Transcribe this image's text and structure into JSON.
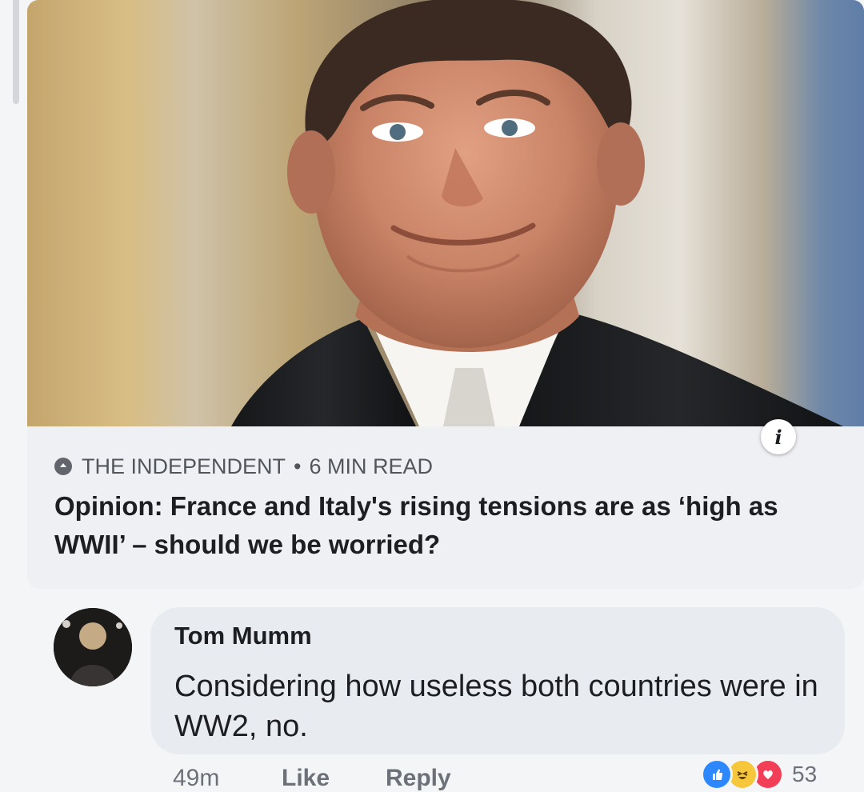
{
  "post": {
    "source_label": "THE INDEPENDENT",
    "separator": "•",
    "read_time": "6 MIN READ",
    "headline": "Opinion: France and Italy's rising tensions are as ‘high as WWII’ – should we be worried?",
    "info_label": "i"
  },
  "comment": {
    "author": "Tom Mumm",
    "text": "Considering how useless both countries were in WW2, no.",
    "time": "49m",
    "like_label": "Like",
    "reply_label": "Reply",
    "reaction_count": "53",
    "reactions": [
      "like-icon",
      "haha-icon",
      "love-icon"
    ]
  },
  "colors": {
    "like": "#2d88ff",
    "haha": "#f7c73b",
    "love": "#f33e58",
    "text": "#1c1e21",
    "muted": "#6c7078"
  }
}
